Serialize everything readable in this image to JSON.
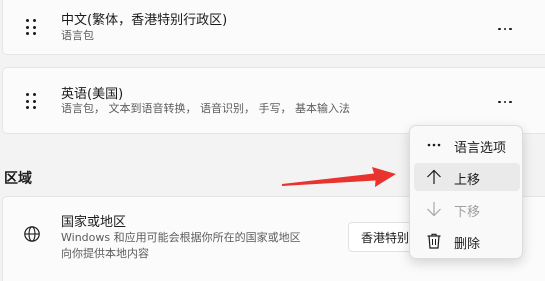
{
  "languages": [
    {
      "name": "中文(繁体，香港特别行政区)",
      "features": "语言包"
    },
    {
      "name": "英语(美国)",
      "features": "语言包， 文本到语音转换， 语音识别， 手写， 基本输入法"
    }
  ],
  "region_section": {
    "heading": "区域",
    "country": {
      "title": "国家或地区",
      "description_line1": "Windows 和应用可能会根据你所在的国家或地区",
      "description_line2": "向你提供本地内容",
      "selected_value": "香港特别行政区"
    }
  },
  "context_menu": {
    "items": [
      {
        "label": "语言选项",
        "icon": "more-horizontal-icon",
        "state": "normal"
      },
      {
        "label": "上移",
        "icon": "arrow-up-icon",
        "state": "hover"
      },
      {
        "label": "下移",
        "icon": "arrow-down-icon",
        "state": "disabled"
      },
      {
        "label": "删除",
        "icon": "trash-icon",
        "state": "normal"
      }
    ]
  },
  "annotation": {
    "arrow_color": "#e8332f"
  }
}
